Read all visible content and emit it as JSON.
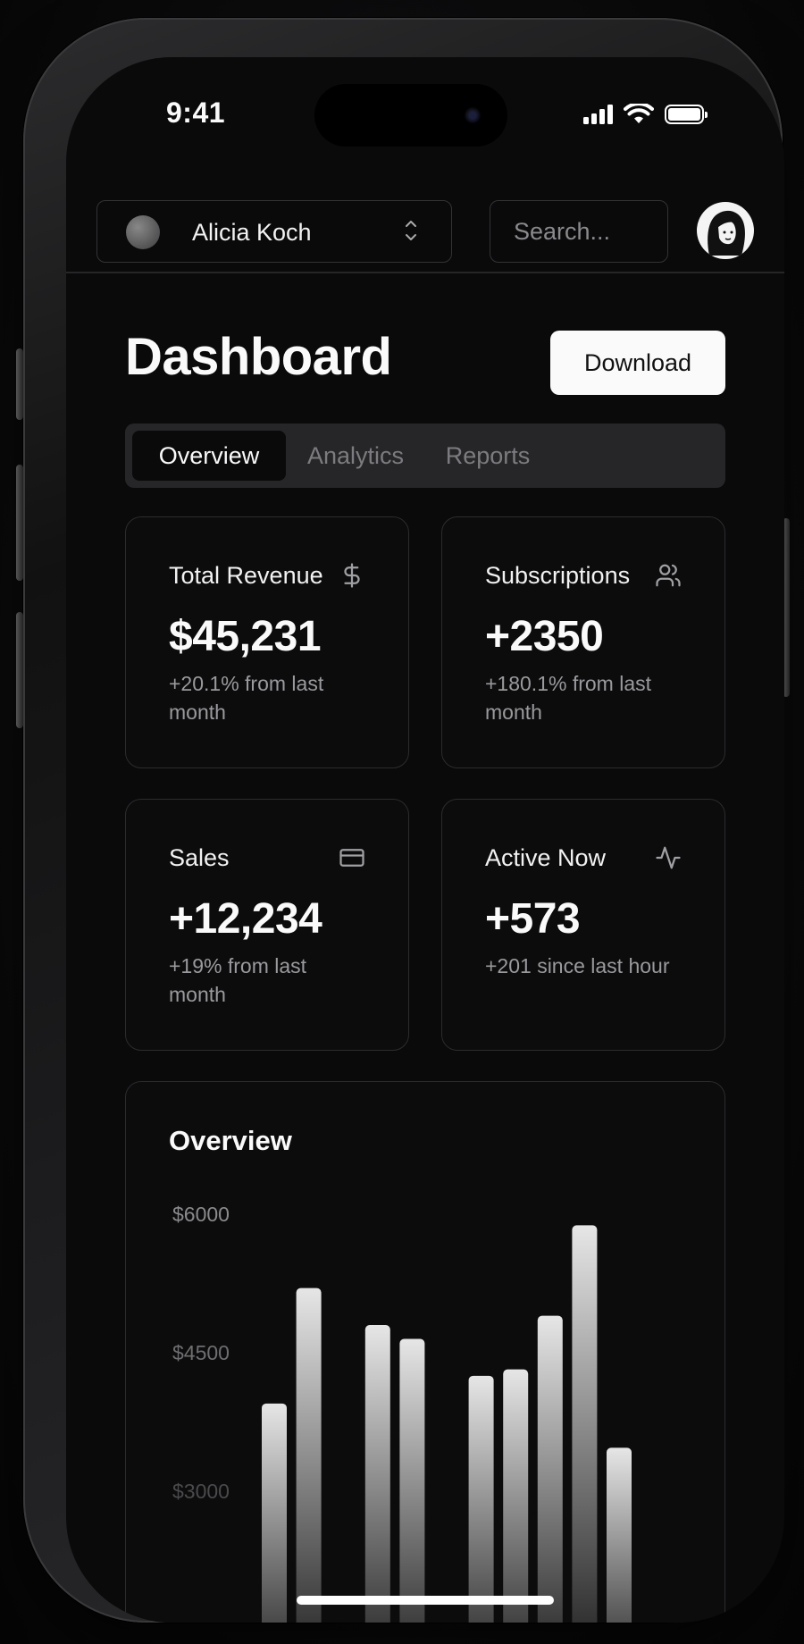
{
  "status_bar": {
    "time": "9:41",
    "icons": [
      "signal-icon",
      "wifi-icon",
      "battery-icon"
    ]
  },
  "header": {
    "account_name": "Alicia Koch",
    "search_placeholder": "Search..."
  },
  "page": {
    "title": "Dashboard",
    "download_label": "Download"
  },
  "tabs": [
    {
      "label": "Overview",
      "active": true
    },
    {
      "label": "Analytics",
      "active": false
    },
    {
      "label": "Reports",
      "active": false
    }
  ],
  "cards": [
    {
      "label": "Total Revenue",
      "icon": "dollar-icon",
      "value": "$45,231",
      "sub": "+20.1% from last month"
    },
    {
      "label": "Subscriptions",
      "icon": "users-icon",
      "value": "+2350",
      "sub": "+180.1% from last month"
    },
    {
      "label": "Sales",
      "icon": "credit-card-icon",
      "value": "+12,234",
      "sub": "+19% from last month"
    },
    {
      "label": "Active Now",
      "icon": "activity-icon",
      "value": "+573",
      "sub": "+201 since last hour"
    }
  ],
  "chart_data": {
    "type": "bar",
    "title": "Overview",
    "ytick_labels": [
      "$6000",
      "$4500",
      "$3000"
    ],
    "ylim": [
      0,
      6000
    ],
    "values": [
      3950,
      5200,
      0,
      4800,
      4650,
      0,
      4250,
      4320,
      4900,
      5880,
      3470
    ],
    "colors": {
      "bar_top": "#e6e6e6",
      "bar_bottom": "#0c0c0d"
    }
  },
  "colors": {
    "background": "#0a0a0b",
    "surface": "#0c0c0d",
    "border": "#2c2c2e",
    "muted_text": "#9a9a9e",
    "button": "#fafafa"
  }
}
